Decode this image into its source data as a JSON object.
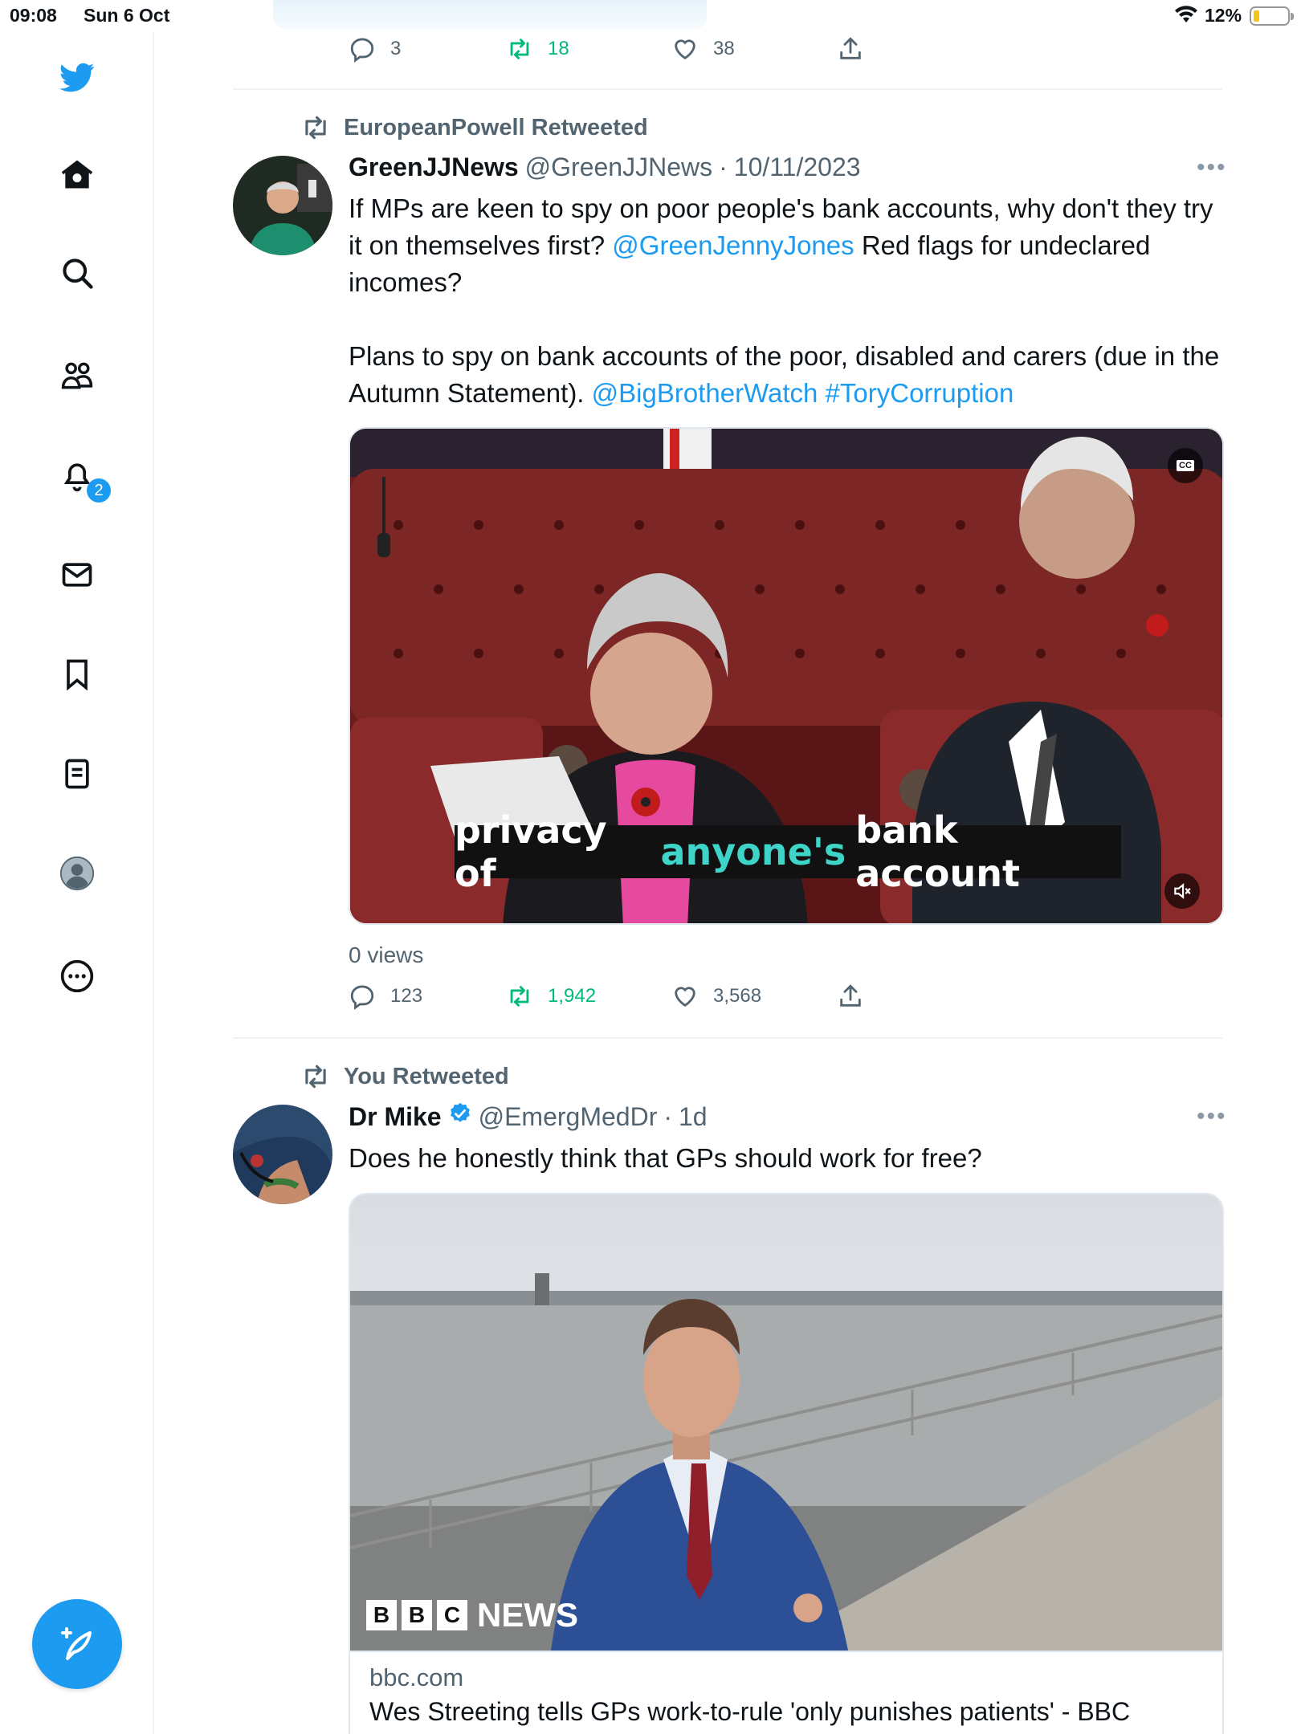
{
  "status_bar": {
    "time": "09:08",
    "date": "Sun 6 Oct",
    "battery": "12%"
  },
  "sidebar": {
    "items": [
      {
        "name": "home"
      },
      {
        "name": "explore"
      },
      {
        "name": "communities"
      },
      {
        "name": "notifications",
        "badge": "2"
      },
      {
        "name": "messages"
      },
      {
        "name": "bookmarks"
      },
      {
        "name": "lists"
      },
      {
        "name": "profile"
      },
      {
        "name": "more"
      }
    ]
  },
  "tweet0": {
    "replies": "3",
    "retweets": "18",
    "likes": "38"
  },
  "tweet1": {
    "retweeted_by": "EuropeanPowell Retweeted",
    "name": "GreenJJNews",
    "handle": "@GreenJJNews",
    "sep": "·",
    "date": "10/11/2023",
    "text_p1": "If MPs are keen to spy on poor people's bank accounts, why don't they try it on themselves first?",
    "mention1": "@GreenJennyJones",
    "text_p1b": "Red flags for undeclared incomes?",
    "text_p2": "Plans to spy on bank accounts of the poor, disabled and carers (due in the Autumn Statement).",
    "mention2": "@BigBrotherWatch",
    "hashtag": "#ToryCorruption",
    "video_caption_a": "privacy of",
    "video_caption_b": "anyone's",
    "video_caption_c": "bank account",
    "cc_label": "CC",
    "views": "0 views",
    "replies": "123",
    "retweets": "1,942",
    "likes": "3,568"
  },
  "tweet2": {
    "retweeted_by": "You Retweeted",
    "name": "Dr Mike",
    "handle": "@EmergMedDr",
    "sep": "·",
    "date": "1d",
    "text": "Does he honestly think that GPs should work for free?",
    "card_brand_b1": "B",
    "card_brand_b2": "B",
    "card_brand_b3": "C",
    "card_brand_news": "NEWS",
    "card_domain": "bbc.com",
    "card_title": "Wes Streeting tells GPs work-to-rule 'only punishes patients' - BBC"
  },
  "colors": {
    "accent": "#1d9bf0",
    "retweet": "#00ba7c",
    "muted": "#536471"
  }
}
